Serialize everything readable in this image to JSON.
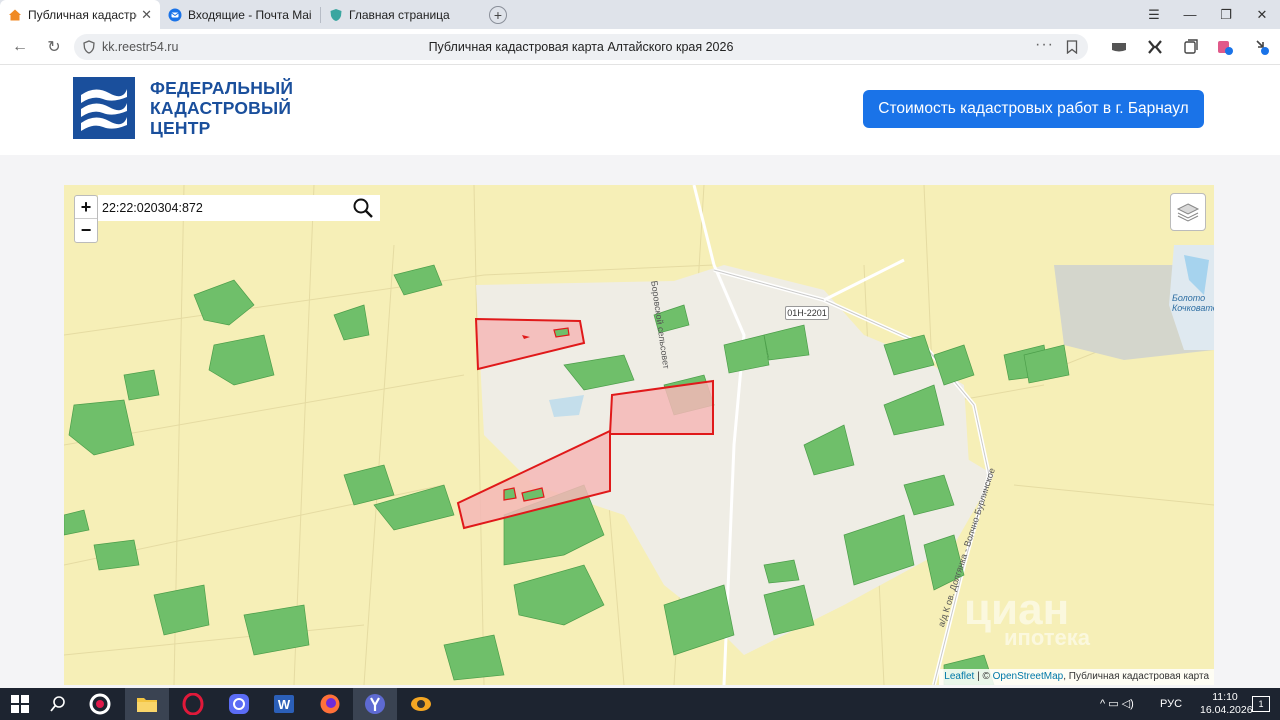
{
  "browser": {
    "tabs": [
      {
        "title": "Публичная кадастрова",
        "active": true
      },
      {
        "title": "Входящие - Почта Mail",
        "active": false
      },
      {
        "title": "Главная страница",
        "active": false
      }
    ],
    "new_tab_label": "+",
    "address": {
      "domain": "kk.reestr54.ru",
      "page_title": "Публичная кадастровая карта Алтайского края 2026"
    }
  },
  "header": {
    "logo_lines": [
      "ФЕДЕРАЛЬНЫЙ",
      "КАДАСТРОВЫЙ",
      "ЦЕНТР"
    ],
    "cta_label": "Стоимость кадастровых работ в г. Барнаул",
    "brand_color": "#1a4f9c",
    "cta_color": "#1a73e8"
  },
  "map": {
    "zoom_in": "+",
    "zoom_out": "−",
    "search_value": "22:22:020304:872",
    "road_badge": "01Н-2201",
    "road_labels": [
      "Боровской сельсовет",
      "а/д К ов. Долгянка - Волчно-Бурлинское",
      "Болото Кочковатое"
    ],
    "attribution": {
      "leaflet": "Leaflet",
      "sep": " | © ",
      "osm": "OpenStreetMap",
      "rest": ", Публичная кадастровая карта"
    },
    "watermark": [
      "циан",
      "ипотека"
    ],
    "colors": {
      "field": "#f6efb7",
      "forest": "#6fbf6a",
      "parcel_fill": "#f4b7b7",
      "parcel_stroke": "#e0191a",
      "settlement": "#efede5"
    }
  },
  "taskbar": {
    "language": "РУС",
    "time": "11:10",
    "date": "16.04.2026",
    "notifications": "1"
  }
}
